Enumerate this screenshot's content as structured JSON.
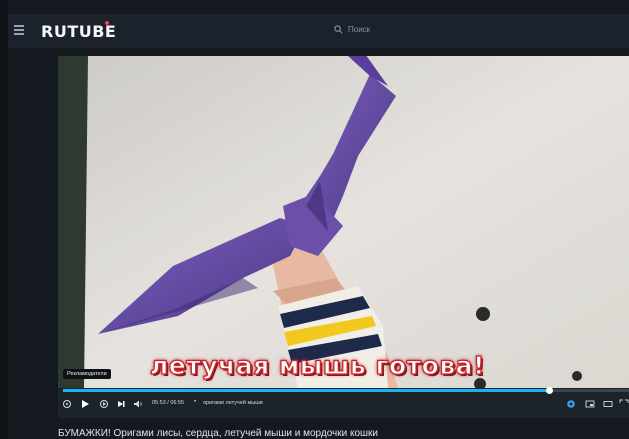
{
  "header": {
    "menu_icon": "hamburger-icon",
    "logo": "RUTUBE",
    "search_icon": "search-icon",
    "search_placeholder": "Поиск"
  },
  "player": {
    "caption": "летучая мышь готова!",
    "tooltip": "Рекламодатели",
    "progress": 0.86,
    "time": "05:53 / 06:55",
    "chapter": "оригами летучей мыши",
    "controls": [
      "replay-icon",
      "play-icon",
      "skip-back-icon",
      "next-icon",
      "volume-icon",
      "settings-icon",
      "miniplayer-icon",
      "theater-icon",
      "fullscreen-icon"
    ]
  },
  "video_title": "БУМАЖКИ! Оригами лисы, сердца, летучей мыши и мордочки кошки",
  "colors": {
    "accent": "#19b5f0",
    "logo_dot": "#ff3b4e",
    "bat": "#6b4fa8",
    "background": "#14191f"
  }
}
